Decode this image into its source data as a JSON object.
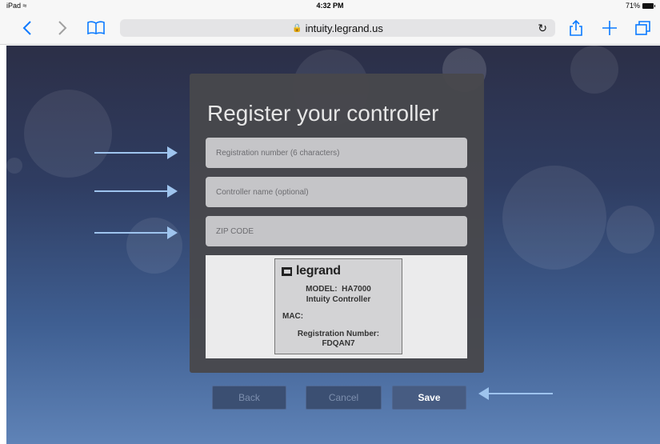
{
  "status_bar": {
    "device": "iPad",
    "time": "4:32 PM",
    "battery": "71%"
  },
  "browser": {
    "url": "intuity.legrand.us"
  },
  "form": {
    "title": "Register your controller",
    "registration_placeholder": "Registration number (6 characters)",
    "controller_name_placeholder": "Controller name (optional)",
    "zip_placeholder": "ZIP CODE"
  },
  "device_label": {
    "brand": "legrand",
    "model_label": "MODEL:",
    "model_value": "HA7000",
    "product": "Intuity Controller",
    "mac_label": "MAC:",
    "registration_label": "Registration Number:",
    "registration_value": "FDQAN7"
  },
  "buttons": {
    "back": "Back",
    "cancel": "Cancel",
    "save": "Save"
  },
  "colors": {
    "accent": "#0a7aff",
    "arrow": "#9ec4ee",
    "card": "#48484c"
  }
}
